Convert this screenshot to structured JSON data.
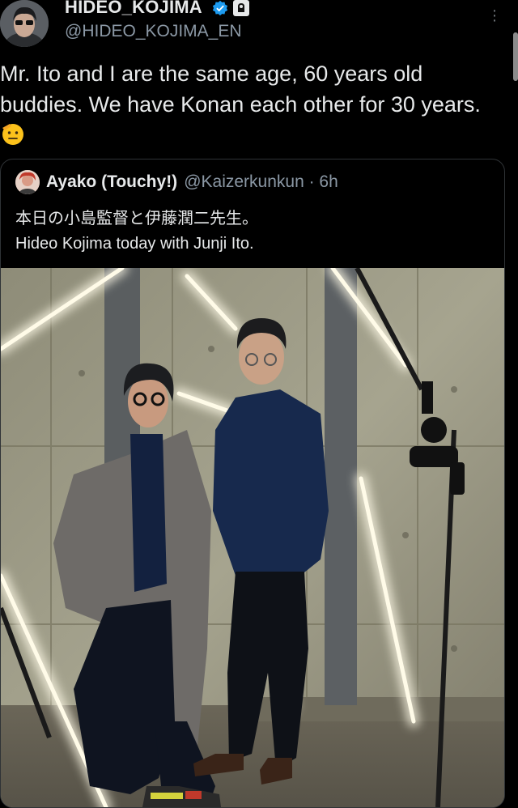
{
  "post": {
    "display_name": "HIDEO_KOJIMA",
    "handle": "@HIDEO_KOJIMA_EN",
    "text": "Mr. Ito and I are the same age, 60 years old buddies. We have Konan each other for 30 years.",
    "icons": {
      "verified": "verified-badge-icon",
      "affiliate": "affiliate-badge-icon",
      "more": "more-options-icon",
      "emoji": "saluting-face-emoji"
    }
  },
  "quote": {
    "author_name": "Ayako (Touchy!)",
    "meta": "@Kaizerkunkun · 6h",
    "text_line1": "本日の小島監督と伊藤潤二先生。",
    "text_line2": "Hideo Kojima today with Junji Ito."
  },
  "colors": {
    "background": "#000000",
    "text": "#e7e9ea",
    "muted": "#8b98a5",
    "verified": "#1d9bf0",
    "border": "#2f3336"
  }
}
